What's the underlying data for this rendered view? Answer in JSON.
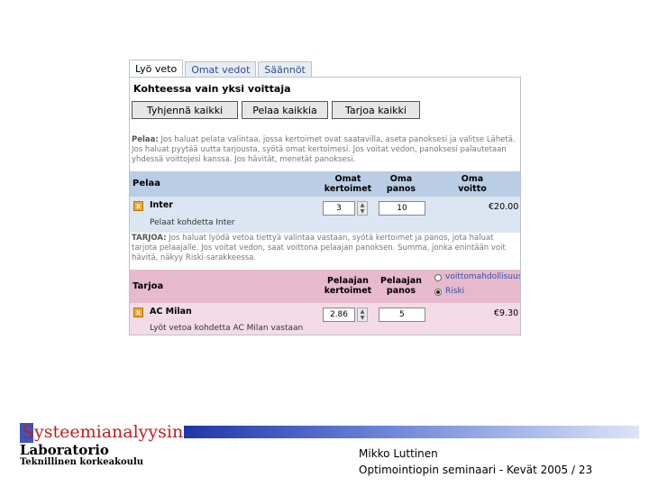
{
  "tabs": [
    "Lyö veto",
    "Omat vedot",
    "Säännöt"
  ],
  "heading": "Kohteessa vain yksi voittaja",
  "buttons": [
    "Tyhjennä kaikki",
    "Pelaa kaikkia",
    "Tarjoa kaikki"
  ],
  "pelaa_info": {
    "label": "Pelaa:",
    "text": " Jos haluat pelata valintaa, jossa kertoimet ovat saatavilla, aseta panoksesi ja valitse Lähetä. Jos haluat pyytää uutta tarjousta, syötä omat kertoimesi. Jos voitat vedon, panoksesi palautetaan yhdessä voittojesi kanssa. Jos hävität, menetät panoksesi."
  },
  "pelaa_section": {
    "title": "Pelaa",
    "col1": [
      "Omat",
      "kertoimet"
    ],
    "col2": [
      "Oma",
      "panos"
    ],
    "col3": [
      "Oma",
      "voitto"
    ]
  },
  "pelaa_row": {
    "selection": "Inter",
    "odds": "3",
    "stake": "10",
    "win": "€20.00",
    "note": "Pelaat kohdetta Inter"
  },
  "tarjoa_info": {
    "label": "TARJOA:",
    "text": " Jos haluat lyödä vetoa tiettyä valintaa vastaan, syötä kertoimet ja panos, jota haluat tarjota pelaajalle. Jos voitat vedon, saat voittona pelaajan panoksen. Summa, jonka enintään voit hävitä, näkyy Riski-sarakkeessa."
  },
  "tarjoa_section": {
    "title": "Tarjoa",
    "col1": [
      "Pelaajan",
      "kertoimet"
    ],
    "col2": [
      "Pelaajan",
      "panos"
    ],
    "radio1": "voittomahdollisuus",
    "radio2": "Riski"
  },
  "tarjoa_row": {
    "selection": "AC Milan",
    "odds": "2.86",
    "stake": "5",
    "risk": "€9.30",
    "note": "Lyöt vetoa kohdetta AC Milan vastaan"
  },
  "footer": {
    "logo_initial": "S",
    "logo_rest": "ysteemianalyysin",
    "lab": "Laboratorio",
    "school": "Teknillinen korkeakoulu",
    "author": "Mikko Luttinen",
    "seminar": "Optimointiopin seminaari - Kevät 2005 / 23"
  },
  "colors": {
    "play_band": "#b9cde4",
    "offer_band": "#e6b9cc",
    "logo_red": "#c01e1e",
    "logo_blue": "#3a56c2"
  }
}
